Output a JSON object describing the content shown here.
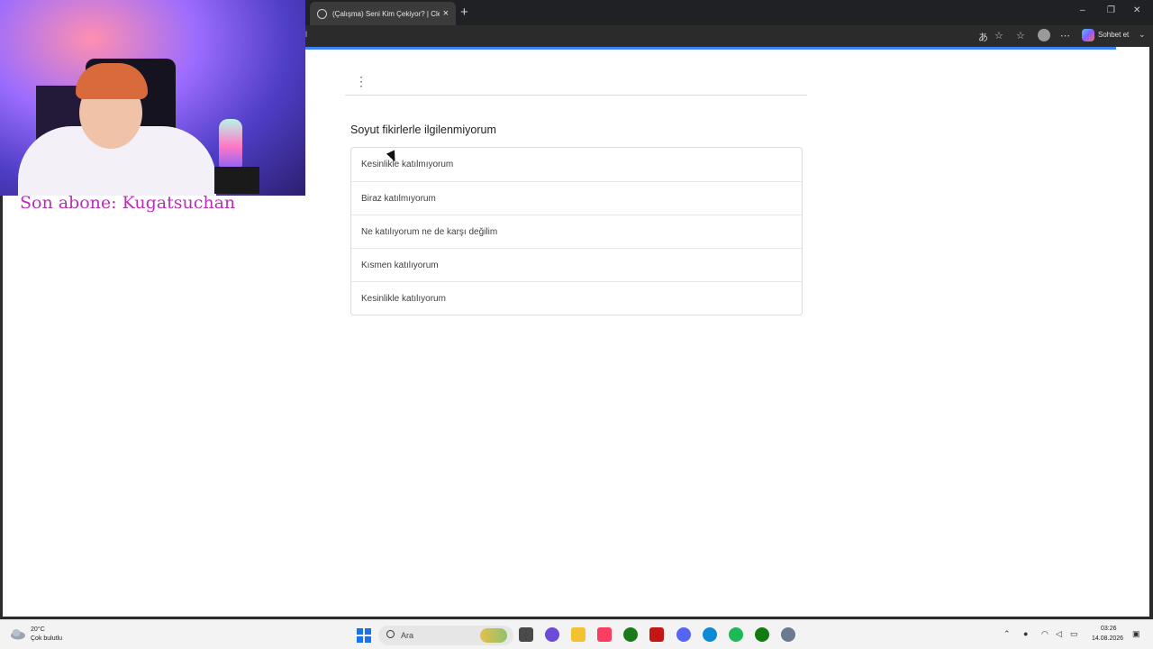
{
  "browser": {
    "tab_title": "(Çalışma) Seni Kim Çekiyor? | Clea",
    "tab_close": "×",
    "new_tab": "+",
    "address_fragment": "l",
    "chat_label": "Sohbet et",
    "min": "–",
    "restore": "❐",
    "close": "✕"
  },
  "overlay": {
    "subscriber_text": "Son abone: Kugatsuchan"
  },
  "form": {
    "menu_glyph": "⋮",
    "question": "Soyut fikirlerle ilgilenmiyorum",
    "options": [
      "Kesinlikle katılmıyorum",
      "Biraz katılmıyorum",
      "Ne katılıyorum ne de karşı değilim",
      "Kısmen katılıyorum",
      "Kesinlikle katılıyorum"
    ]
  },
  "taskbar": {
    "weather_temp": "20°C",
    "weather_desc": "Çok bulutlu",
    "search_label": "Ara",
    "time": "03:26",
    "date": "14.08.2026"
  },
  "colors": {
    "accent": "#3b82f6",
    "subscriber": "#b92fb5"
  }
}
